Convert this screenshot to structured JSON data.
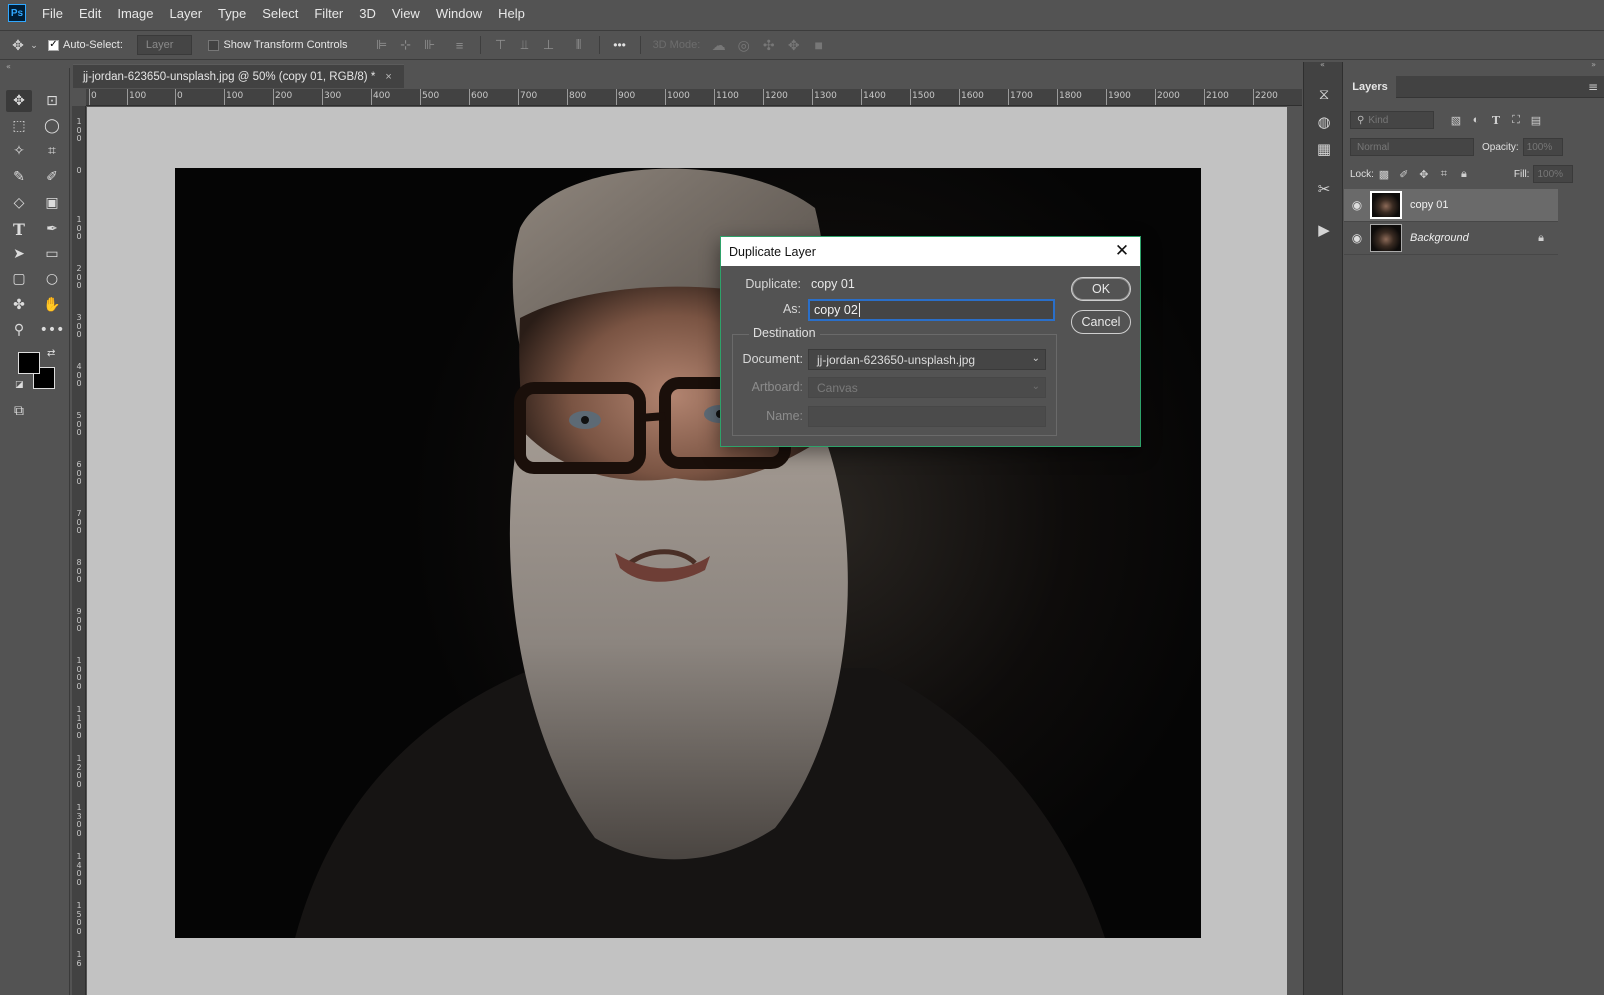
{
  "app": {
    "logo_text": "Ps"
  },
  "menu": [
    "File",
    "Edit",
    "Image",
    "Layer",
    "Type",
    "Select",
    "Filter",
    "3D",
    "View",
    "Window",
    "Help"
  ],
  "options": {
    "auto_select_label": "Auto-Select:",
    "auto_select_checked": true,
    "auto_select_target": "Layer",
    "show_transform_label": "Show Transform Controls",
    "show_transform_checked": false,
    "more_label": "•••",
    "mode_3d_label": "3D Mode:"
  },
  "document": {
    "tab_title": "jj-jordan-623650-unsplash.jpg @ 50% (copy 01, RGB/8) *",
    "close_glyph": "×"
  },
  "ruler": {
    "top_labels": [
      "0",
      "100",
      "0",
      "100",
      "200",
      "300",
      "400",
      "500",
      "600",
      "700",
      "800",
      "900",
      "1000",
      "1100",
      "1200",
      "1300",
      "1400",
      "1500",
      "1600",
      "1700",
      "1800",
      "1900",
      "2000",
      "2100",
      "2200"
    ],
    "left_labels": [
      "1\n0\n0",
      "0",
      "1\n0\n0",
      "2\n0\n0",
      "3\n0\n0",
      "4\n0\n0",
      "5\n0\n0",
      "6\n0\n0",
      "7\n0\n0",
      "8\n0\n0",
      "9\n0\n0",
      "1\n0\n0\n0",
      "1\n1\n0\n0",
      "1\n2\n0\n0",
      "1\n3\n0\n0",
      "1\n4\n0\n0",
      "1\n5\n0\n0",
      "1\n6"
    ]
  },
  "layers_panel": {
    "tab_label": "Layers",
    "filter_placeholder": "Kind",
    "blend_mode": "Normal",
    "opacity_label": "Opacity:",
    "opacity_value": "100%",
    "lock_label": "Lock:",
    "fill_label": "Fill:",
    "fill_value": "100%",
    "layers": [
      {
        "name": "copy 01",
        "selected": true,
        "italic": false,
        "locked": false
      },
      {
        "name": "Background",
        "selected": false,
        "italic": true,
        "locked": true
      }
    ]
  },
  "dialog": {
    "title": "Duplicate Layer",
    "duplicate_label": "Duplicate:",
    "duplicate_value": "copy 01",
    "as_label": "As:",
    "as_value": "copy 02",
    "ok_label": "OK",
    "cancel_label": "Cancel",
    "destination_label": "Destination",
    "document_label": "Document:",
    "document_value": "jj-jordan-623650-unsplash.jpg",
    "artboard_label": "Artboard:",
    "artboard_value": "Canvas",
    "name_label": "Name:",
    "name_value": ""
  },
  "colors": {
    "dialog_border": "#2ea26a",
    "input_focus": "#2a6fc9",
    "foreground": "#000000",
    "background": "#000000"
  }
}
